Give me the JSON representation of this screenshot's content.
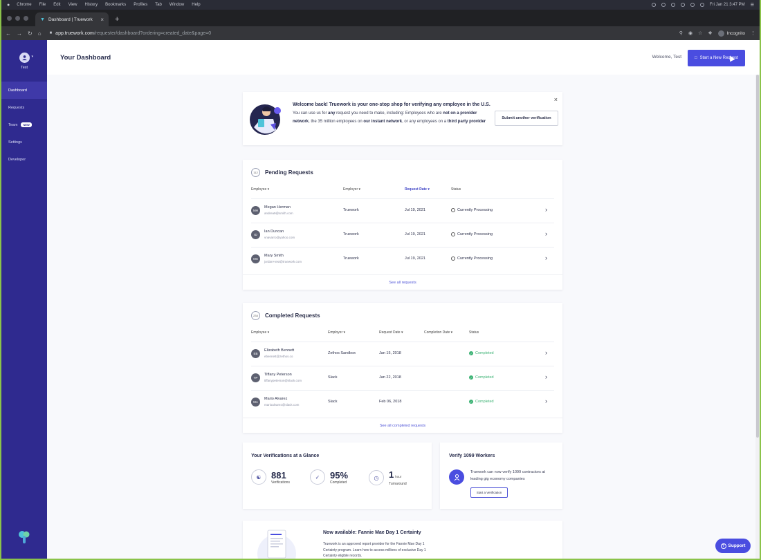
{
  "menubar": {
    "items": [
      "Chrome",
      "File",
      "Edit",
      "View",
      "History",
      "Bookmarks",
      "Profiles",
      "Tab",
      "Window",
      "Help"
    ],
    "clock": "Fri Jan 21  3:47 PM"
  },
  "browser": {
    "tab_title": "Dashboard | Truework",
    "url_host": "app.truework.com",
    "url_path": "/requester/dashboard?ordering=created_date&page=0",
    "incognito_label": "Incognito"
  },
  "sidebar": {
    "user_name": "Test",
    "items": [
      {
        "label": "Dashboard"
      },
      {
        "label": "Requests"
      },
      {
        "label": "Team",
        "badge": "NEW"
      },
      {
        "label": "Settings"
      },
      {
        "label": "Developer"
      }
    ]
  },
  "header": {
    "title": "Your Dashboard",
    "welcome": "Welcome, Test",
    "cta_label": "Start a New Request"
  },
  "welcome_card": {
    "headline": "Welcome back! Truework is your one-stop shop for verifying any employee in the U.S.",
    "body_1": "You can use us for",
    "body_2": "any",
    "body_3": "request you need to make, including: Employees who are",
    "body_4": "not on a provider network",
    "body_5": ", the 35 million employees on",
    "body_6": "our instant network",
    "body_7": ", or any employees on a",
    "body_8": "third party provider",
    "submit_label": "Submit another verification"
  },
  "pending": {
    "count": "112",
    "title": "Pending Requests",
    "columns": {
      "employee": "Employee ▾",
      "employer": "Employer ▾",
      "request_date": "Request Date ▾",
      "status": "Status"
    },
    "rows": [
      {
        "initials": "MH",
        "name": "Megan Herman",
        "email": "andrea9@smith.com",
        "employer": "Truework",
        "date": "Jul 19, 2021",
        "status": "Currently Processing"
      },
      {
        "initials": "ID",
        "name": "Ian Duncan",
        "email": "vnavarro@yahoo.com",
        "employer": "Truework",
        "date": "Jul 19, 2021",
        "status": "Currently Processing"
      },
      {
        "initials": "MS",
        "name": "Mary Smith",
        "email": "jordan+test@truework.com",
        "employer": "Truework",
        "date": "Jul 19, 2021",
        "status": "Currently Processing"
      }
    ],
    "see_all": "See all requests"
  },
  "completed": {
    "count": "234",
    "title": "Completed Requests",
    "columns": {
      "employee": "Employee ▾",
      "employer": "Employer ▾",
      "request_date": "Request Date ▾",
      "completion_date": "Completion Date ▾",
      "status": "Status"
    },
    "rows": [
      {
        "initials": "EB",
        "name": "Elizabeth Bennett",
        "email": "ebennett@zethos.co",
        "employer": "Zethos Sandbox",
        "date": "Jan 15, 2018",
        "status": "Completed"
      },
      {
        "initials": "TP",
        "name": "Tiffany Peterson",
        "email": "tiffanypeterson@slack.com",
        "employer": "Slack",
        "date": "Jan 22, 2018",
        "status": "Completed"
      },
      {
        "initials": "MA",
        "name": "Mario Alvarez",
        "email": "marioalvarez@slack.com",
        "employer": "Slack",
        "date": "Feb 06, 2018",
        "status": "Completed"
      }
    ],
    "see_all": "See all completed requests"
  },
  "glance": {
    "title": "Your Verifications at a Glance",
    "stats": [
      {
        "value": "881",
        "unit": "",
        "label": "Verifications"
      },
      {
        "value": "95%",
        "unit": "",
        "label": "Completed"
      },
      {
        "value": "1",
        "unit": "hour",
        "label": "Turnaround"
      }
    ]
  },
  "verify_1099": {
    "title": "Verify 1099 Workers",
    "desc": "Truework can now verify 1099 contractors at leading gig economy companies",
    "button": "Start a Verification"
  },
  "fannie": {
    "title": "Now available: Fannie Mae Day 1 Certainty",
    "desc": "Truework is an approved report provider for the Fannie Mae Day 1 Certainty program. Learn how to access millions of exclusive Day 1 Certainty eligible records."
  },
  "support_label": "Support",
  "colors": {
    "brand": "#2f2a8f",
    "accent": "#4a4de0",
    "success": "#3bb273"
  }
}
